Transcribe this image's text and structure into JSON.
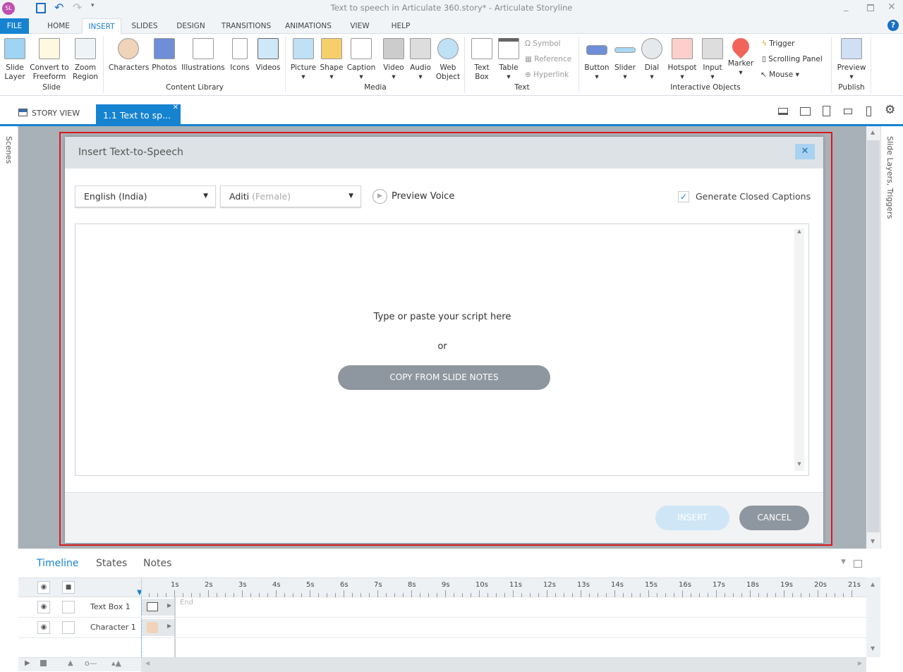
{
  "window": {
    "title": "Text to speech in Articulate 360.story* -  Articulate Storyline",
    "app_icon": "SL"
  },
  "ribbon_tabs": [
    "FILE",
    "HOME",
    "INSERT",
    "SLIDES",
    "DESIGN",
    "TRANSITIONS",
    "ANIMATIONS",
    "VIEW",
    "HELP"
  ],
  "active_tab": "INSERT",
  "ribbon": {
    "groups": [
      {
        "label": "Slide",
        "items": [
          {
            "l1": "Slide",
            "l2": "Layer"
          },
          {
            "l1": "Convert to",
            "l2": "Freeform"
          },
          {
            "l1": "Zoom",
            "l2": "Region"
          }
        ]
      },
      {
        "label": "Content Library",
        "items": [
          {
            "l1": "Characters"
          },
          {
            "l1": "Photos"
          },
          {
            "l1": "Illustrations"
          },
          {
            "l1": "Icons"
          },
          {
            "l1": "Videos"
          }
        ]
      },
      {
        "label": "Media",
        "items": [
          {
            "l1": "Picture"
          },
          {
            "l1": "Shape"
          },
          {
            "l1": "Caption"
          },
          {
            "l1": "Video"
          },
          {
            "l1": "Audio"
          },
          {
            "l1": "Web",
            "l2": "Object"
          }
        ]
      },
      {
        "label": "Text",
        "items": [
          {
            "l1": "Text",
            "l2": "Box"
          },
          {
            "l1": "Table"
          }
        ],
        "small": [
          "Symbol",
          "Reference",
          "Hyperlink"
        ]
      },
      {
        "label": "Interactive Objects",
        "items": [
          {
            "l1": "Button"
          },
          {
            "l1": "Slider"
          },
          {
            "l1": "Dial"
          },
          {
            "l1": "Hotspot"
          },
          {
            "l1": "Input"
          },
          {
            "l1": "Marker"
          }
        ],
        "small": [
          "Trigger",
          "Scrolling Panel",
          "Mouse"
        ]
      },
      {
        "label": "Publish",
        "items": [
          {
            "l1": "Preview"
          }
        ]
      }
    ]
  },
  "doc_tabs": {
    "story_view": "STORY VIEW",
    "slide_tab": "1.1 Text to sp..."
  },
  "side_panels": {
    "left": "Scenes",
    "right": "Slide Layers, Triggers"
  },
  "dialog": {
    "title": "Insert Text-to-Speech",
    "language": "English (India)",
    "voice": "Aditi",
    "voice_gender": "(Female)",
    "preview_voice": "Preview Voice",
    "closed_captions_label": "Generate Closed Captions",
    "closed_captions_checked": true,
    "script_placeholder": "Type or paste your script here",
    "or": "or",
    "copy_notes": "COPY FROM SLIDE NOTES",
    "insert": "INSERT",
    "cancel": "CANCEL"
  },
  "timeline": {
    "tabs": [
      "Timeline",
      "States",
      "Notes"
    ],
    "active": "Timeline",
    "ticks": [
      "1s",
      "2s",
      "3s",
      "4s",
      "5s",
      "6s",
      "7s",
      "8s",
      "9s",
      "10s",
      "11s",
      "12s",
      "13s",
      "14s",
      "15s",
      "16s",
      "17s",
      "18s",
      "19s",
      "20s",
      "21s"
    ],
    "end_label": "End",
    "rows": [
      {
        "name": "Text Box 1"
      },
      {
        "name": "Character 1"
      }
    ]
  },
  "colors": {
    "accent": "#1683d0",
    "highlight_border": "#d9181e"
  }
}
